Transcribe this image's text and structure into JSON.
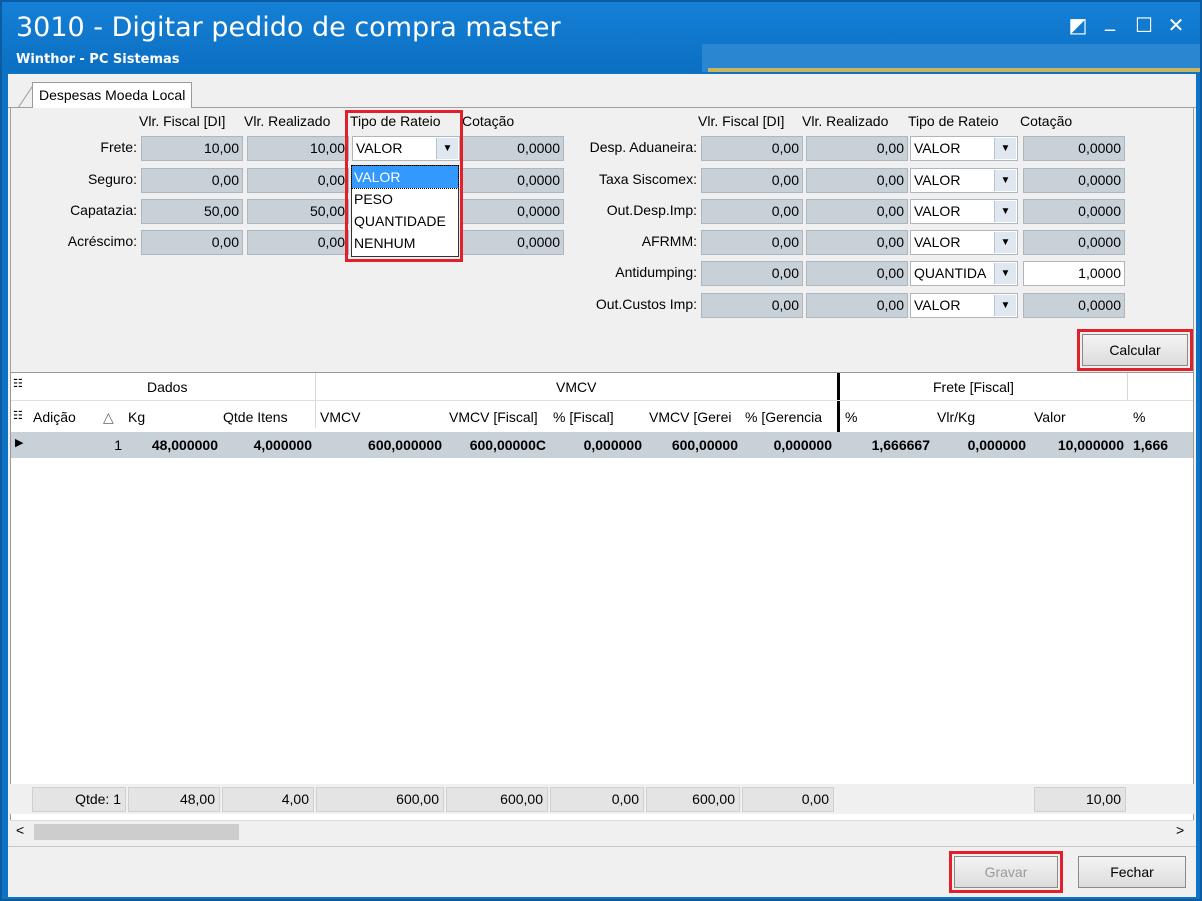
{
  "window": {
    "title": "3010 - Digitar pedido de compra master",
    "subtitle": "Winthor - PC Sistemas",
    "controls": {
      "restore": "◩",
      "minimize": "_",
      "maximize": "☐",
      "close": "✕"
    }
  },
  "tab": {
    "label": "Despesas Moeda Local"
  },
  "left_headers": {
    "fiscal": "Vlr. Fiscal [DI]",
    "realizado": "Vlr. Realizado",
    "rateio": "Tipo de Rateio",
    "cotacao": "Cotação"
  },
  "right_headers": {
    "fiscal": "Vlr. Fiscal [DI]",
    "realizado": "Vlr. Realizado",
    "rateio": "Tipo de Rateio",
    "cotacao": "Cotação"
  },
  "left_rows": [
    {
      "label": "Frete:",
      "fiscal": "10,00",
      "realizado": "10,00",
      "rateio": "VALOR",
      "cotacao": "0,0000"
    },
    {
      "label": "Seguro:",
      "fiscal": "0,00",
      "realizado": "0,00",
      "rateio": "",
      "cotacao": "0,0000"
    },
    {
      "label": "Capatazia:",
      "fiscal": "50,00",
      "realizado": "50,00",
      "rateio": "",
      "cotacao": "0,0000"
    },
    {
      "label": "Acréscimo:",
      "fiscal": "0,00",
      "realizado": "0,00",
      "rateio": "",
      "cotacao": "0,0000"
    }
  ],
  "dropdown_options": [
    "VALOR",
    "PESO",
    "QUANTIDADE",
    "NENHUM"
  ],
  "right_rows": [
    {
      "label": "Desp. Aduaneira:",
      "fiscal": "0,00",
      "realizado": "0,00",
      "rateio": "VALOR",
      "cotacao": "0,0000"
    },
    {
      "label": "Taxa Siscomex:",
      "fiscal": "0,00",
      "realizado": "0,00",
      "rateio": "VALOR",
      "cotacao": "0,0000"
    },
    {
      "label": "Out.Desp.Imp:",
      "fiscal": "0,00",
      "realizado": "0,00",
      "rateio": "VALOR",
      "cotacao": "0,0000"
    },
    {
      "label": "AFRMM:",
      "fiscal": "0,00",
      "realizado": "0,00",
      "rateio": "VALOR",
      "cotacao": "0,0000"
    },
    {
      "label": "Antidumping:",
      "fiscal": "0,00",
      "realizado": "0,00",
      "rateio": "QUANTIDA",
      "cotacao": "1,0000"
    },
    {
      "label": "Out.Custos Imp:",
      "fiscal": "0,00",
      "realizado": "0,00",
      "rateio": "VALOR",
      "cotacao": "0,0000"
    }
  ],
  "buttons": {
    "calcular": "Calcular",
    "gravar": "Gravar",
    "fechar": "Fechar"
  },
  "grid": {
    "bands": [
      "Dados",
      "VMCV",
      "Frete [Fiscal]"
    ],
    "columns": [
      "Adição",
      "Kg",
      "Qtde Itens",
      "VMCV",
      "VMCV [Fiscal]",
      "% [Fiscal]",
      "VMCV [Gerei",
      "% [Gerencia",
      "%",
      "Vlr/Kg",
      "Valor",
      "%"
    ],
    "sort_indicator": "△",
    "row_indicator": "▶",
    "row": [
      "1",
      "48,000000",
      "4,000000",
      "600,000000",
      "600,00000C",
      "0,000000",
      "600,00000",
      "0,000000",
      "1,666667",
      "0,000000",
      "10,000000",
      "1,666"
    ]
  },
  "footer": [
    "Qtde: 1",
    "48,00",
    "4,00",
    "600,00",
    "600,00",
    "0,00",
    "600,00",
    "0,00",
    "10,00"
  ],
  "scroll": {
    "left": "<",
    "right": ">"
  }
}
